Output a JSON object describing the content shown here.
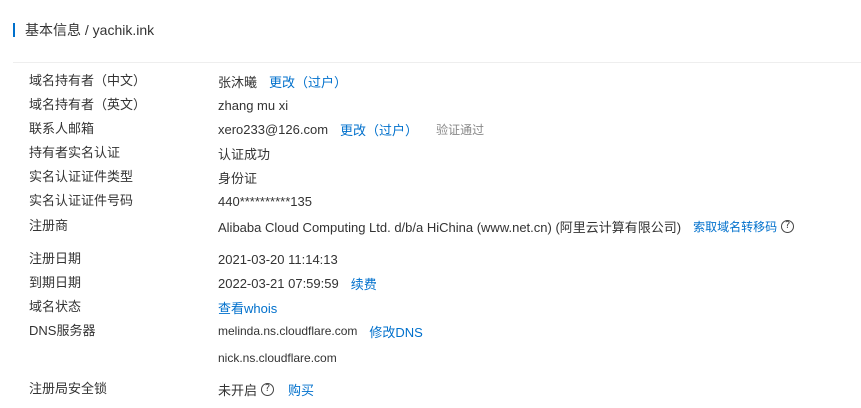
{
  "header": {
    "title": "基本信息 / yachik.ink"
  },
  "rows": {
    "owner_cn": {
      "label": "域名持有者（中文）",
      "value": "张沐曦",
      "action": "更改（过户）"
    },
    "owner_en": {
      "label": "域名持有者（英文）",
      "value": "zhang mu xi"
    },
    "email": {
      "label": "联系人邮箱",
      "value": "xero233@126.com",
      "action": "更改（过户）",
      "status": "验证通过"
    },
    "realname": {
      "label": "持有者实名认证",
      "value": "认证成功"
    },
    "cert_type": {
      "label": "实名认证证件类型",
      "value": "身份证"
    },
    "cert_no": {
      "label": "实名认证证件号码",
      "value": "440**********135"
    },
    "registrar": {
      "label": "注册商",
      "value": "Alibaba Cloud Computing Ltd. d/b/a HiChina (www.net.cn) (阿里云计算有限公司)",
      "action": "索取域名转移码"
    },
    "reg_date": {
      "label": "注册日期",
      "value": "2021-03-20 11:14:13"
    },
    "exp_date": {
      "label": "到期日期",
      "value": "2022-03-21 07:59:59",
      "action": "续费"
    },
    "status": {
      "label": "域名状态",
      "action": "查看whois"
    },
    "dns": {
      "label": "DNS服务器",
      "servers": [
        "melinda.ns.cloudflare.com",
        "nick.ns.cloudflare.com"
      ],
      "action": "修改DNS"
    },
    "lock": {
      "label": "注册局安全锁",
      "value": "未开启",
      "action": "购买"
    }
  },
  "colors": {
    "link": "#0070cc",
    "text": "#333333",
    "muted": "#888888",
    "accent_bar": "#0070cc"
  }
}
